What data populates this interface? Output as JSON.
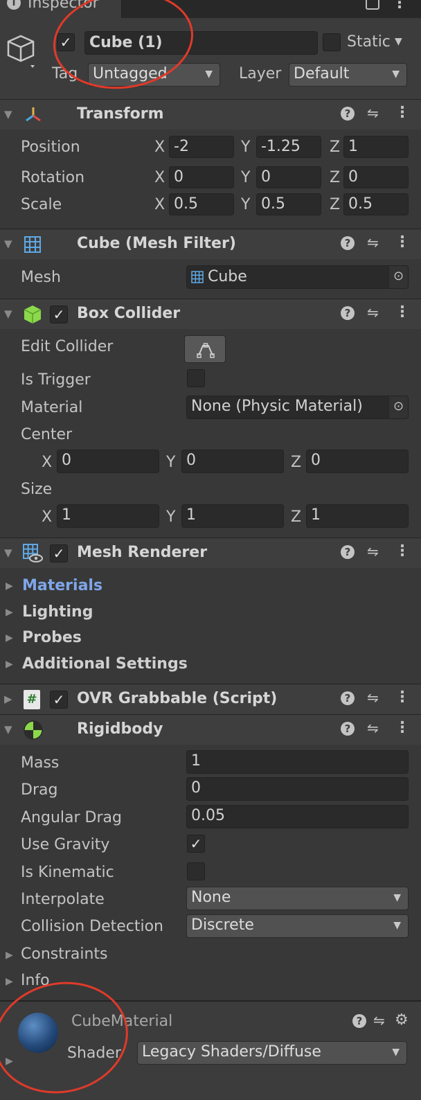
{
  "window": {
    "tab_title": "Inspector"
  },
  "object": {
    "active_checked": true,
    "name": "Cube (1)",
    "static_label": "Static",
    "tag_label": "Tag",
    "tag_value": "Untagged",
    "layer_label": "Layer",
    "layer_value": "Default"
  },
  "transform": {
    "title": "Transform",
    "position_label": "Position",
    "rotation_label": "Rotation",
    "scale_label": "Scale",
    "x": "X",
    "y": "Y",
    "z": "Z",
    "position": [
      "-2",
      "-1.25",
      "1"
    ],
    "rotation": [
      "0",
      "0",
      "0"
    ],
    "scale": [
      "0.5",
      "0.5",
      "0.5"
    ]
  },
  "mesh_filter": {
    "title": "Cube (Mesh Filter)",
    "mesh_label": "Mesh",
    "mesh_value": "Cube"
  },
  "box_collider": {
    "title": "Box Collider",
    "enabled": true,
    "edit_collider_label": "Edit Collider",
    "is_trigger_label": "Is Trigger",
    "material_label": "Material",
    "material_value": "None (Physic Material)",
    "center_label": "Center",
    "center": [
      "0",
      "0",
      "0"
    ],
    "size_label": "Size",
    "size": [
      "1",
      "1",
      "1"
    ]
  },
  "mesh_renderer": {
    "title": "Mesh Renderer",
    "enabled": true,
    "foldouts": [
      "Materials",
      "Lighting",
      "Probes",
      "Additional Settings"
    ]
  },
  "ovr_grabbable": {
    "title": "OVR Grabbable (Script)",
    "enabled": true
  },
  "rigidbody": {
    "title": "Rigidbody",
    "mass_label": "Mass",
    "mass": "1",
    "drag_label": "Drag",
    "drag": "0",
    "angular_drag_label": "Angular Drag",
    "angular_drag": "0.05",
    "use_gravity_label": "Use Gravity",
    "use_gravity": true,
    "is_kinematic_label": "Is Kinematic",
    "is_kinematic": false,
    "interpolate_label": "Interpolate",
    "interpolate": "None",
    "collision_label": "Collision Detection",
    "collision": "Discrete",
    "constraints_label": "Constraints",
    "info_label": "Info"
  },
  "material": {
    "name": "CubeMaterial",
    "shader_label": "Shader",
    "shader_value": "Legacy Shaders/Diffuse"
  },
  "colors": {
    "background": "#383838",
    "header": "#3e3e3e",
    "field": "#2a2a2a",
    "foldout_link": "#7ea6e8",
    "annotation_circle": "#e03a2a"
  },
  "icons": [
    "transform-icon",
    "mesh-filter-icon",
    "box-collider-icon",
    "mesh-renderer-icon",
    "script-icon",
    "rigidbody-icon",
    "help-icon",
    "presets-icon",
    "menu-icon",
    "object-picker-icon",
    "lock-icon",
    "gear-icon"
  ]
}
